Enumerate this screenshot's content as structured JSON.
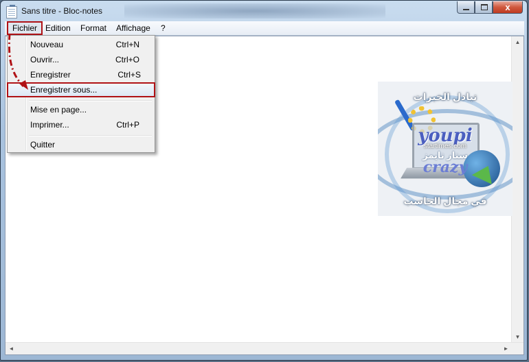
{
  "window": {
    "title": "Sans titre - Bloc-notes",
    "close_glyph": "x"
  },
  "menubar": {
    "items": [
      "Fichier",
      "Edition",
      "Format",
      "Affichage",
      "?"
    ],
    "active_index": 0
  },
  "file_menu": {
    "items": [
      {
        "label": "Nouveau",
        "shortcut": "Ctrl+N"
      },
      {
        "label": "Ouvrir...",
        "shortcut": "Ctrl+O"
      },
      {
        "label": "Enregistrer",
        "shortcut": "Ctrl+S"
      },
      {
        "label": "Enregistrer sous...",
        "shortcut": ""
      },
      {
        "label": "Mise en page...",
        "shortcut": ""
      },
      {
        "label": "Imprimer...",
        "shortcut": "Ctrl+P"
      },
      {
        "label": "Quitter",
        "shortcut": ""
      }
    ],
    "highlighted_index": 3
  },
  "editor": {
    "content": ""
  },
  "scrollbar": {
    "up": "▲",
    "down": "▼",
    "left": "◄",
    "right": "►"
  },
  "logo": {
    "line1": "تبادل الخبرات",
    "line2": "youpi",
    "line3": "startimes.com",
    "line4": "ستار تايمز",
    "line5": "crazy",
    "line6": "في مجال الحاسب"
  },
  "colors": {
    "annotation": "#b01216",
    "menu_bg": "#f0f0f0"
  }
}
